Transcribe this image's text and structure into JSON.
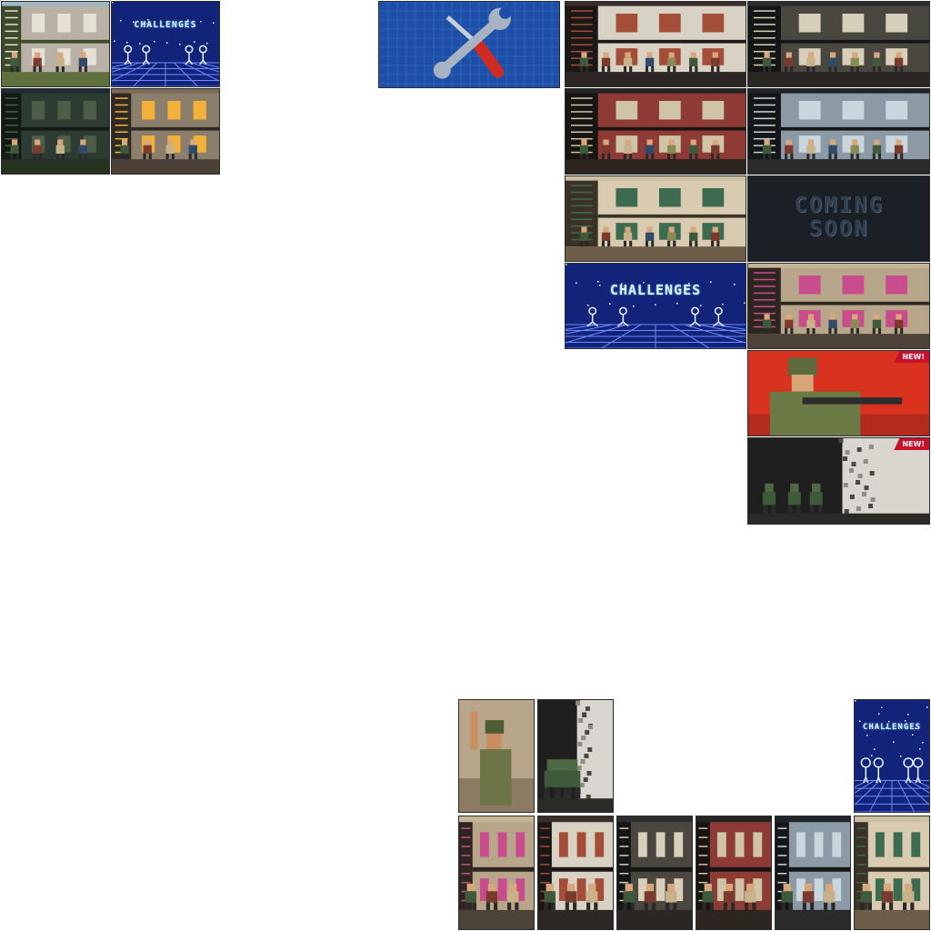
{
  "atlas": {
    "challenges_label": "CHALLENGES",
    "coming_soon_line1": "COMING",
    "coming_soon_line2": "SOON",
    "new_badge": "NEW!"
  },
  "tiles": [
    {
      "name": "thumb-suburb-van",
      "kind": "scene",
      "theme": "suburb"
    },
    {
      "name": "thumb-challenges-small",
      "kind": "challenges"
    },
    {
      "name": "thumb-jungle-night",
      "kind": "scene",
      "theme": "jungle"
    },
    {
      "name": "thumb-ruins-fire",
      "kind": "scene",
      "theme": "ruins"
    },
    {
      "name": "settings-tools-tile",
      "kind": "tools",
      "icon": "wrench-screwdriver-icon"
    },
    {
      "name": "level-warehouse-ladder",
      "kind": "scene",
      "theme": "warehouse"
    },
    {
      "name": "level-office-meeting",
      "kind": "scene",
      "theme": "office"
    },
    {
      "name": "level-mansion-dining",
      "kind": "scene",
      "theme": "mansion"
    },
    {
      "name": "level-glass-office",
      "kind": "scene",
      "theme": "glass"
    },
    {
      "name": "level-courtyard-villa",
      "kind": "scene",
      "theme": "courtyard"
    },
    {
      "name": "level-coming-soon",
      "kind": "soon"
    },
    {
      "name": "level-challenges-large",
      "kind": "challenges"
    },
    {
      "name": "level-market-laundry",
      "kind": "scene",
      "theme": "market"
    },
    {
      "name": "campaign-soldier-poster",
      "kind": "poster",
      "badge": true
    },
    {
      "name": "campaign-squad-breach",
      "kind": "squad",
      "badge": true
    },
    {
      "name": "portrait-commander-art",
      "kind": "poster2"
    },
    {
      "name": "portrait-squad-breach",
      "kind": "squad"
    },
    {
      "name": "portrait-challenges",
      "kind": "challenges"
    },
    {
      "name": "portrait-market",
      "kind": "scene",
      "theme": "market"
    },
    {
      "name": "portrait-warehouse",
      "kind": "scene",
      "theme": "warehouse"
    },
    {
      "name": "portrait-office",
      "kind": "scene",
      "theme": "office"
    },
    {
      "name": "portrait-mansion",
      "kind": "scene",
      "theme": "mansion"
    },
    {
      "name": "portrait-glass-office",
      "kind": "scene",
      "theme": "glass"
    },
    {
      "name": "portrait-courtyard",
      "kind": "scene",
      "theme": "courtyard"
    }
  ],
  "colors": {
    "challenge_bg": "#12237a",
    "grid_line": "#6f8dff",
    "tools_bg": "#1d4fa8",
    "soon_bg": "#1a2026",
    "badge_red": "#c8102e"
  }
}
